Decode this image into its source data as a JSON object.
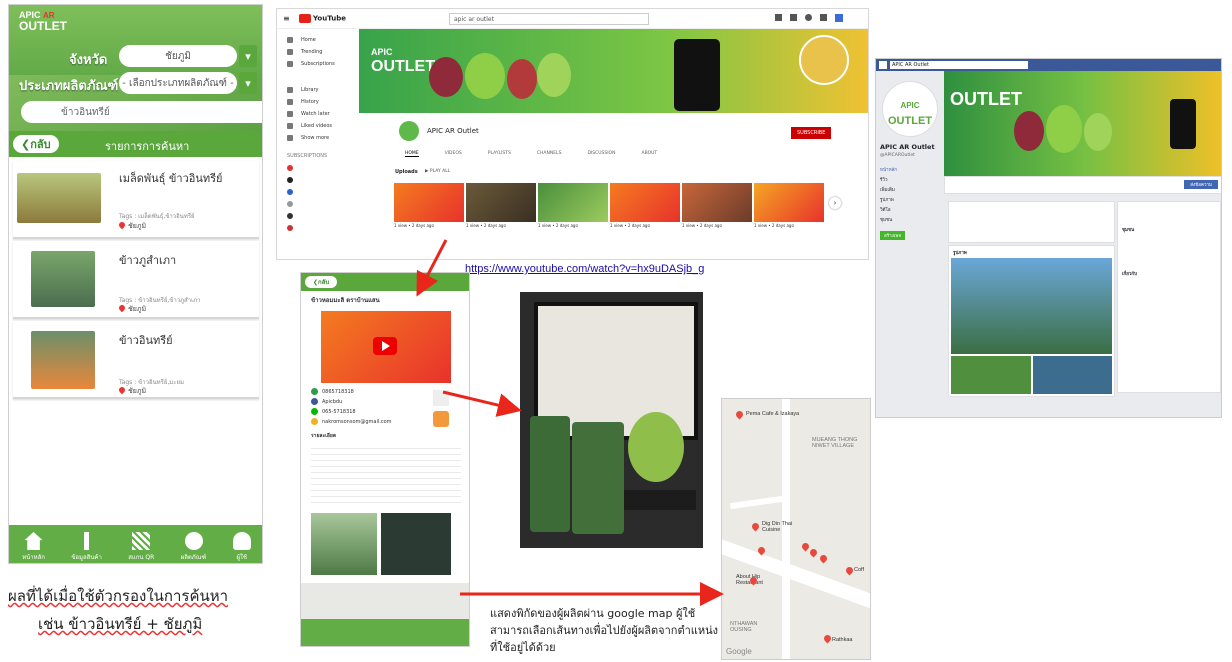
{
  "colors": {
    "green": "#5aa73c",
    "red_arrow": "#e8261c",
    "youtube_red": "#cc0000",
    "facebook_blue": "#3b5998"
  },
  "app": {
    "logo_top": "APIC",
    "logo_ar": "AR",
    "logo_bottom": "OUTLET",
    "province_label": "จังหวัด",
    "province_value": "ชัยภูมิ",
    "type_label": "ประเภทผลิตภัณฑ์",
    "type_value": "- เลือกประเภทผลิตภัณฑ์ -",
    "search_value": "ข้าวอินทรีย์",
    "back_label": "กลับ",
    "results_title": "รายการการค้นหา",
    "results": [
      {
        "title": "เมล็ดพันธุ์ ข้าวอินทรีย์",
        "tags": "Tags : เมล็ดพันธุ์,ข้าวอินทรีย์",
        "location": "ชัยภูมิ"
      },
      {
        "title": "ข้าวภูสำเภา",
        "tags": "Tags : ข้าวอินทรีย์,ข้าวภูสำเภา",
        "location": "ชัยภูมิ"
      },
      {
        "title": "ข้าวอินทรีย์",
        "tags": "Tags : ข้าวอินทรีย์,มะยม",
        "location": "ชัยภูมิ"
      }
    ],
    "nav": [
      "หน้าหลัก",
      "ข้อมูลสินค้า",
      "สแกน QR",
      "ผลิตภัณฑ์",
      "ผู้ใช้"
    ]
  },
  "caption_left_line1": "ผลที่ได้เมื่อใช้ตัวกรองในการค้นหา",
  "caption_left_line2": "เช่น ข้าวอินทรีย์ + ชัยภูมิ",
  "youtube": {
    "logo": "YouTube",
    "search_value": "apic ar outlet",
    "sidebar": [
      "Home",
      "Trending",
      "Subscriptions",
      "Library",
      "History",
      "Watch later",
      "Liked videos",
      "Show more"
    ],
    "subs_title": "SUBSCRIPTIONS",
    "channel_name": "APIC AR Outlet",
    "subscribe": "SUBSCRIBE",
    "tabs": [
      "HOME",
      "VIDEOS",
      "PLAYLISTS",
      "CHANNELS",
      "DISCUSSION",
      "ABOUT"
    ],
    "uploads_label": "Uploads",
    "play_all": "PLAY ALL",
    "video_views": "1 view • 2 days ago"
  },
  "youtube_url": "https://www.youtube.com/watch?v=hx9uDASjb_g",
  "facebook": {
    "page_search": "APIC AR Outlet",
    "page_name": "APIC AR Outlet",
    "handle": "@APICAROutlet",
    "menu": [
      "หน้าหลัก",
      "รีวิว",
      "เพิ่มเติม",
      "รูปภาพ",
      "วิดีโอ",
      "ชุมชน"
    ],
    "create_button": "สร้างเพจ",
    "send_message": "ส่งข้อความ",
    "community_title": "ชุมชน",
    "about_title": "เกี่ยวกับ",
    "photos_title": "รูปภาพ"
  },
  "product": {
    "back_label": "กลับ",
    "title": "ข้าวหอมมะลิ ตราบ้านแสน",
    "phone": "0865718318",
    "facebook": "Apicbdu",
    "line": "065-5718318",
    "email": "nakromsonsom@gmail.com",
    "details_title": "รายละเอียด"
  },
  "map": {
    "labels": [
      "Pema Cafe & Izakaya",
      "MUEANG THONG NIWET VILLAGE",
      "Dig Din Thai Cuisine",
      "About Hip Restaurant",
      "Rathkaa",
      "NTHAWAN OUSING",
      "Coff"
    ]
  },
  "caption_right": "แสดงพิกัดของผู้ผลิตผ่าน google map ผู้ใช้สามารถเลือกเส้นทางเพื่อไปยังผู้ผลิตจากตำแหน่งที่ใช้อยู่ได้ด้วย"
}
